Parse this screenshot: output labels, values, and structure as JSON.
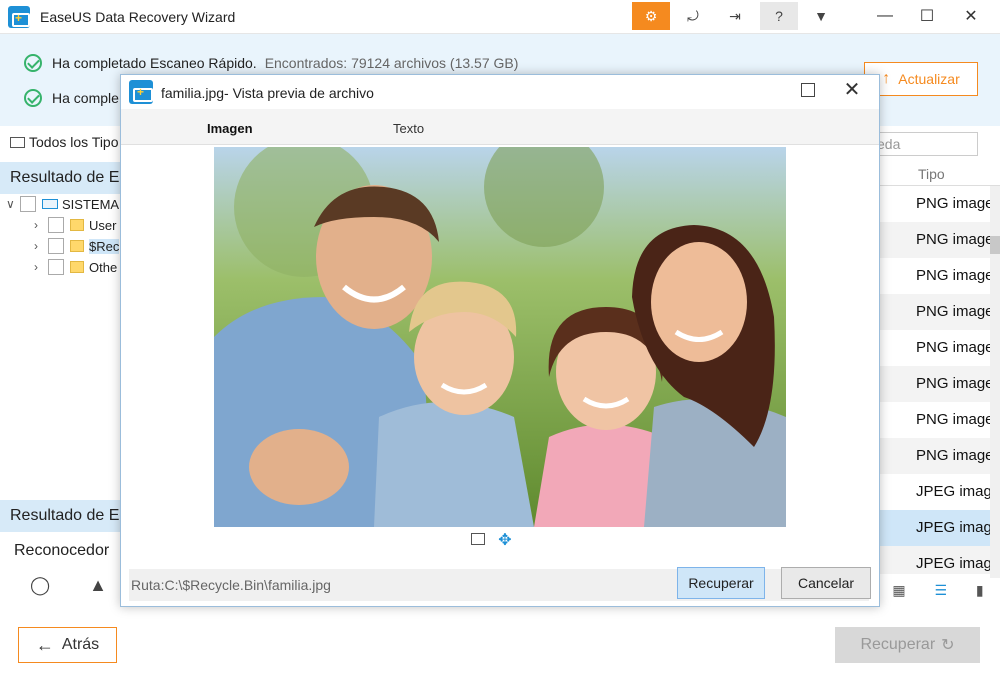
{
  "app": {
    "title": "EaseUS Data Recovery Wizard",
    "accent": "#f58a1f",
    "brand": "#1e90d6",
    "toolbar_icons": [
      "key-icon",
      "share-icon",
      "exit-icon",
      "help-icon",
      "menu-icon"
    ]
  },
  "status": {
    "row1_text": "Ha completado Escaneo Rápido.",
    "row1_count": "Encontrados: 79124 archivos (13.57 GB)",
    "row2_text": "Ha comple",
    "update_label": "Actualizar"
  },
  "filter": {
    "types_label": "Todos los Tipo",
    "search_placeholder": "eda"
  },
  "left": {
    "result_head_1": "Resultado de E",
    "result_head_2": "Resultado de E",
    "tree": [
      {
        "label": "SISTEMA"
      },
      {
        "label": "User"
      },
      {
        "label": "$Rec"
      },
      {
        "label": "Othe"
      }
    ],
    "reconocedor": "Reconocedor"
  },
  "table": {
    "type_header": "Tipo",
    "types": [
      "PNG image",
      "PNG image",
      "PNG image",
      "PNG image",
      "PNG image",
      "PNG image",
      "PNG image",
      "PNG image",
      "JPEG imag",
      "JPEG imag",
      "JPEG imag"
    ]
  },
  "footer": {
    "back_label": "Atrás",
    "recover_label": "Recuperar"
  },
  "dialog": {
    "title": "familia.jpg- Vista previa de archivo",
    "tab_image": "Imagen",
    "tab_text": "Texto",
    "path": "Ruta:C:\\$Recycle.Bin\\familia.jpg",
    "recover_label": "Recuperar",
    "cancel_label": "Cancelar"
  }
}
